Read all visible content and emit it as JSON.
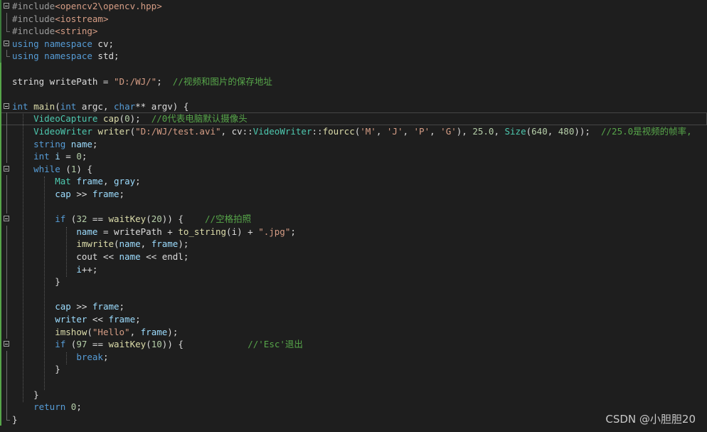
{
  "editor": {
    "lines": [
      {
        "fold": "open",
        "tokens": [
          [
            "pre",
            "#include"
          ],
          [
            "str",
            "<opencv2\\opencv.hpp>"
          ]
        ]
      },
      {
        "fold": "line",
        "tokens": [
          [
            "pre",
            "#include"
          ],
          [
            "str",
            "<iostream>"
          ]
        ]
      },
      {
        "fold": "end",
        "tokens": [
          [
            "pre",
            "#include"
          ],
          [
            "str",
            "<string>"
          ]
        ]
      },
      {
        "fold": "open",
        "tokens": [
          [
            "kw",
            "using"
          ],
          [
            "txt",
            " "
          ],
          [
            "kw",
            "namespace"
          ],
          [
            "txt",
            " cv;"
          ]
        ]
      },
      {
        "fold": "end",
        "tokens": [
          [
            "kw",
            "using"
          ],
          [
            "txt",
            " "
          ],
          [
            "kw",
            "namespace"
          ],
          [
            "txt",
            " std;"
          ]
        ]
      },
      {
        "fold": "",
        "tokens": []
      },
      {
        "fold": "",
        "tokens": [
          [
            "txt",
            "string writePath = "
          ],
          [
            "str",
            "\"D:/WJ/\""
          ],
          [
            "txt",
            ";  "
          ],
          [
            "com",
            "//视频和图片的保存地址"
          ]
        ]
      },
      {
        "fold": "",
        "tokens": []
      },
      {
        "fold": "open",
        "tokens": [
          [
            "kw",
            "int"
          ],
          [
            "txt",
            " "
          ],
          [
            "fn",
            "main"
          ],
          [
            "txt",
            "("
          ],
          [
            "kw",
            "int"
          ],
          [
            "txt",
            " argc, "
          ],
          [
            "kw",
            "char"
          ],
          [
            "txt",
            "** argv) {"
          ]
        ]
      },
      {
        "fold": "line",
        "current": true,
        "tokens": [
          [
            "txt",
            "    "
          ],
          [
            "type",
            "VideoCapture"
          ],
          [
            "txt",
            " "
          ],
          [
            "fn",
            "cap"
          ],
          [
            "txt",
            "("
          ],
          [
            "num",
            "0"
          ],
          [
            "txt",
            ");  "
          ],
          [
            "com",
            "//0代表电脑默认摄像头"
          ]
        ]
      },
      {
        "fold": "line",
        "tokens": [
          [
            "txt",
            "    "
          ],
          [
            "type",
            "VideoWriter"
          ],
          [
            "txt",
            " "
          ],
          [
            "fn",
            "writer"
          ],
          [
            "txt",
            "("
          ],
          [
            "str",
            "\"D:/WJ/test.avi\""
          ],
          [
            "txt",
            ", cv::"
          ],
          [
            "type",
            "VideoWriter"
          ],
          [
            "txt",
            "::"
          ],
          [
            "fn",
            "fourcc"
          ],
          [
            "txt",
            "("
          ],
          [
            "str",
            "'M'"
          ],
          [
            "txt",
            ", "
          ],
          [
            "str",
            "'J'"
          ],
          [
            "txt",
            ", "
          ],
          [
            "str",
            "'P'"
          ],
          [
            "txt",
            ", "
          ],
          [
            "str",
            "'G'"
          ],
          [
            "txt",
            "), "
          ],
          [
            "num",
            "25.0"
          ],
          [
            "txt",
            ", "
          ],
          [
            "type",
            "Size"
          ],
          [
            "txt",
            "("
          ],
          [
            "num",
            "640"
          ],
          [
            "txt",
            ", "
          ],
          [
            "num",
            "480"
          ],
          [
            "txt",
            "));  "
          ],
          [
            "com",
            "//25.0是视频的帧率,"
          ]
        ]
      },
      {
        "fold": "line",
        "tokens": [
          [
            "txt",
            "    "
          ],
          [
            "kw",
            "string"
          ],
          [
            "txt",
            " "
          ],
          [
            "var",
            "name"
          ],
          [
            "txt",
            ";"
          ]
        ]
      },
      {
        "fold": "line",
        "tokens": [
          [
            "txt",
            "    "
          ],
          [
            "kw",
            "int"
          ],
          [
            "txt",
            " "
          ],
          [
            "var",
            "i"
          ],
          [
            "txt",
            " = "
          ],
          [
            "num",
            "0"
          ],
          [
            "txt",
            ";"
          ]
        ]
      },
      {
        "fold": "open",
        "tokens": [
          [
            "txt",
            "    "
          ],
          [
            "kw",
            "while"
          ],
          [
            "txt",
            " ("
          ],
          [
            "num",
            "1"
          ],
          [
            "txt",
            ") {"
          ]
        ]
      },
      {
        "fold": "line",
        "tokens": [
          [
            "txt",
            "        "
          ],
          [
            "type",
            "Mat"
          ],
          [
            "txt",
            " "
          ],
          [
            "var",
            "frame"
          ],
          [
            "txt",
            ", "
          ],
          [
            "var",
            "gray"
          ],
          [
            "txt",
            ";"
          ]
        ]
      },
      {
        "fold": "line",
        "tokens": [
          [
            "txt",
            "        "
          ],
          [
            "var",
            "cap"
          ],
          [
            "txt",
            " >> "
          ],
          [
            "var",
            "frame"
          ],
          [
            "txt",
            ";"
          ]
        ]
      },
      {
        "fold": "line",
        "tokens": []
      },
      {
        "fold": "open",
        "tokens": [
          [
            "txt",
            "        "
          ],
          [
            "kw",
            "if"
          ],
          [
            "txt",
            " ("
          ],
          [
            "num",
            "32"
          ],
          [
            "txt",
            " == "
          ],
          [
            "fn",
            "waitKey"
          ],
          [
            "txt",
            "("
          ],
          [
            "num",
            "20"
          ],
          [
            "txt",
            ")) {    "
          ],
          [
            "com",
            "//空格拍照"
          ]
        ]
      },
      {
        "fold": "line",
        "tokens": [
          [
            "txt",
            "            "
          ],
          [
            "var",
            "name"
          ],
          [
            "txt",
            " = writePath + "
          ],
          [
            "fn",
            "to_string"
          ],
          [
            "txt",
            "(i) + "
          ],
          [
            "str",
            "\".jpg\""
          ],
          [
            "txt",
            ";"
          ]
        ]
      },
      {
        "fold": "line",
        "tokens": [
          [
            "txt",
            "            "
          ],
          [
            "fn",
            "imwrite"
          ],
          [
            "txt",
            "("
          ],
          [
            "var",
            "name"
          ],
          [
            "txt",
            ", "
          ],
          [
            "var",
            "frame"
          ],
          [
            "txt",
            ");"
          ]
        ]
      },
      {
        "fold": "line",
        "tokens": [
          [
            "txt",
            "            cout << "
          ],
          [
            "var",
            "name"
          ],
          [
            "txt",
            " << endl;"
          ]
        ]
      },
      {
        "fold": "line",
        "tokens": [
          [
            "txt",
            "            "
          ],
          [
            "var",
            "i"
          ],
          [
            "txt",
            "++;"
          ]
        ]
      },
      {
        "fold": "line",
        "tokens": [
          [
            "txt",
            "        }"
          ]
        ]
      },
      {
        "fold": "line",
        "tokens": []
      },
      {
        "fold": "line",
        "tokens": [
          [
            "txt",
            "        "
          ],
          [
            "var",
            "cap"
          ],
          [
            "txt",
            " >> "
          ],
          [
            "var",
            "frame"
          ],
          [
            "txt",
            ";"
          ]
        ]
      },
      {
        "fold": "line",
        "tokens": [
          [
            "txt",
            "        "
          ],
          [
            "var",
            "writer"
          ],
          [
            "txt",
            " << "
          ],
          [
            "var",
            "frame"
          ],
          [
            "txt",
            ";"
          ]
        ]
      },
      {
        "fold": "line",
        "tokens": [
          [
            "txt",
            "        "
          ],
          [
            "fn",
            "imshow"
          ],
          [
            "txt",
            "("
          ],
          [
            "str",
            "\"Hello\""
          ],
          [
            "txt",
            ", "
          ],
          [
            "var",
            "frame"
          ],
          [
            "txt",
            ");"
          ]
        ]
      },
      {
        "fold": "open",
        "tokens": [
          [
            "txt",
            "        "
          ],
          [
            "kw",
            "if"
          ],
          [
            "txt",
            " ("
          ],
          [
            "num",
            "97"
          ],
          [
            "txt",
            " == "
          ],
          [
            "fn",
            "waitKey"
          ],
          [
            "txt",
            "("
          ],
          [
            "num",
            "10"
          ],
          [
            "txt",
            ")) {            "
          ],
          [
            "com",
            "//'Esc'退出"
          ]
        ]
      },
      {
        "fold": "line",
        "tokens": [
          [
            "txt",
            "            "
          ],
          [
            "kw",
            "break"
          ],
          [
            "txt",
            ";"
          ]
        ]
      },
      {
        "fold": "line",
        "tokens": [
          [
            "txt",
            "        }"
          ]
        ]
      },
      {
        "fold": "line",
        "tokens": []
      },
      {
        "fold": "line",
        "tokens": [
          [
            "txt",
            "    }"
          ]
        ]
      },
      {
        "fold": "line",
        "tokens": [
          [
            "txt",
            "    "
          ],
          [
            "kw",
            "return"
          ],
          [
            "txt",
            " "
          ],
          [
            "num",
            "0"
          ],
          [
            "txt",
            ";"
          ]
        ]
      },
      {
        "fold": "end",
        "tokens": [
          [
            "txt",
            "}"
          ]
        ]
      }
    ]
  },
  "watermark": "CSDN @小胆胆20"
}
